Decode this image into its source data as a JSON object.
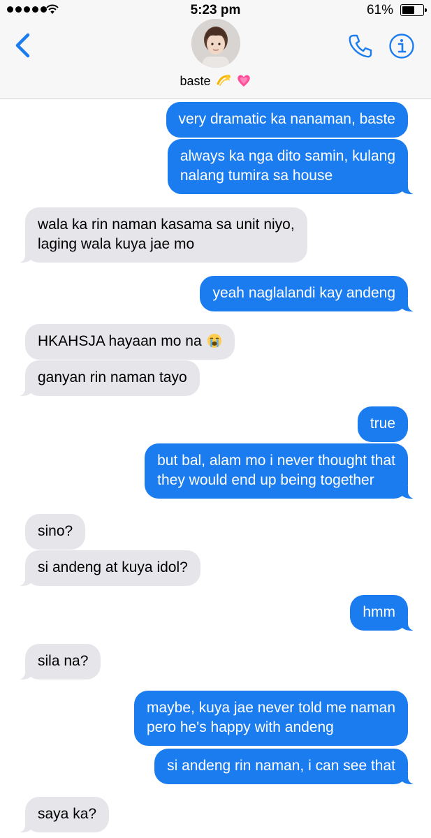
{
  "status_bar": {
    "time": "5:23 pm",
    "battery": "61%",
    "battery_level": 0.61
  },
  "header": {
    "contact_name": "baste",
    "name_emojis": [
      "dizzy-emoji",
      "growing-heart-emoji"
    ]
  },
  "colors": {
    "accent": "#1b7cf0",
    "received_bubble": "#e6e5ea"
  },
  "messages": [
    {
      "from": "me",
      "text": "very dramatic ka nanaman, baste"
    },
    {
      "from": "me",
      "text": "always ka nga dito samin, kulang",
      "text2": "nalang tumira sa house"
    },
    {
      "from": "them",
      "text": "wala ka rin naman kasama sa unit niyo,",
      "text2": "laging wala kuya jae mo"
    },
    {
      "from": "me",
      "text": "yeah naglalandi kay andeng"
    },
    {
      "from": "them",
      "text": "HKAHSJA hayaan mo na",
      "emoji": "loudly-crying-face-emoji"
    },
    {
      "from": "them",
      "text": "ganyan rin naman tayo"
    },
    {
      "from": "me",
      "text": "true"
    },
    {
      "from": "me",
      "text": "but bal, alam mo i never thought that",
      "text2": "they would end up being together"
    },
    {
      "from": "them",
      "text": "sino?"
    },
    {
      "from": "them",
      "text": "si andeng at kuya idol?"
    },
    {
      "from": "me",
      "text": "hmm"
    },
    {
      "from": "them",
      "text": "sila na?"
    },
    {
      "from": "me",
      "text": "maybe, kuya jae never told me naman",
      "text2": "pero he's happy with andeng"
    },
    {
      "from": "me",
      "text": "si andeng rin naman, i can see that"
    },
    {
      "from": "them",
      "text": "saya ka?"
    }
  ]
}
